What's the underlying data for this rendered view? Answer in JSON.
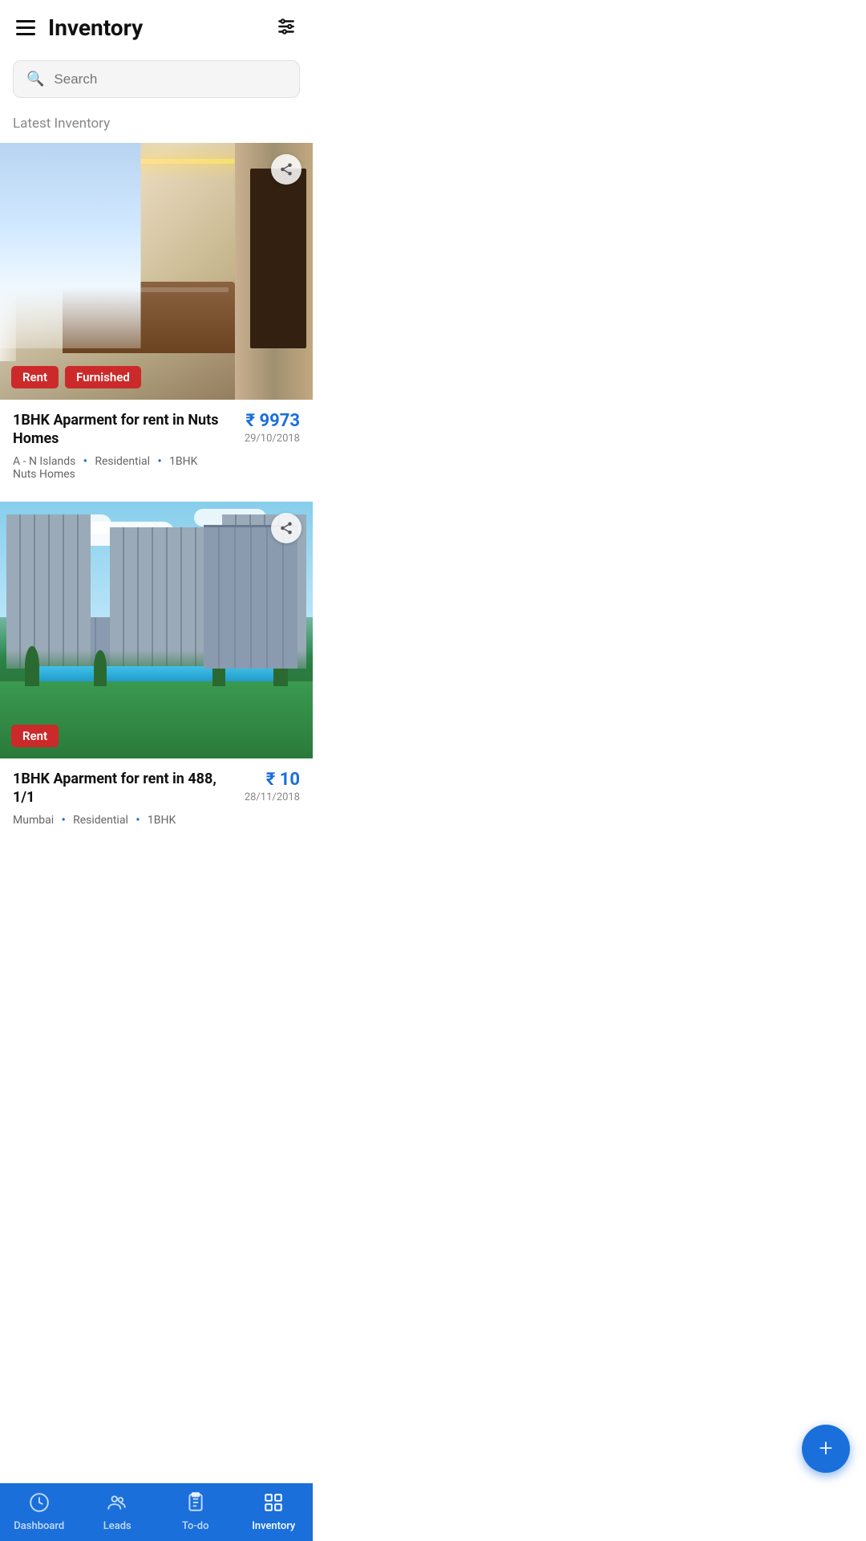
{
  "header": {
    "title": "Inventory",
    "hamburger_label": "menu",
    "filter_label": "filter"
  },
  "search": {
    "placeholder": "Search"
  },
  "section": {
    "latest_label": "Latest Inventory"
  },
  "cards": [
    {
      "id": "card-1",
      "image_type": "interior",
      "tags": [
        "Rent",
        "Furnished"
      ],
      "title": "1BHK Aparment for rent in Nuts Homes",
      "price": "₹ 9973",
      "date": "29/10/2018",
      "location": "A - N Islands",
      "category": "Residential",
      "bhk": "1BHK",
      "project": "Nuts Homes"
    },
    {
      "id": "card-2",
      "image_type": "exterior",
      "tags": [
        "Rent"
      ],
      "title": "1BHK Aparment for rent in 488, 1/1",
      "price": "₹ 10",
      "date": "28/11/2018",
      "location": "Mumbai",
      "category": "Residential",
      "bhk": "1BHK",
      "project": ""
    }
  ],
  "fab": {
    "label": "+"
  },
  "nav": {
    "items": [
      {
        "id": "dashboard",
        "label": "Dashboard",
        "icon": "clock",
        "active": false
      },
      {
        "id": "leads",
        "label": "Leads",
        "icon": "people",
        "active": false
      },
      {
        "id": "todo",
        "label": "To-do",
        "icon": "clipboard",
        "active": false
      },
      {
        "id": "inventory",
        "label": "Inventory",
        "icon": "inventory",
        "active": true
      }
    ]
  }
}
